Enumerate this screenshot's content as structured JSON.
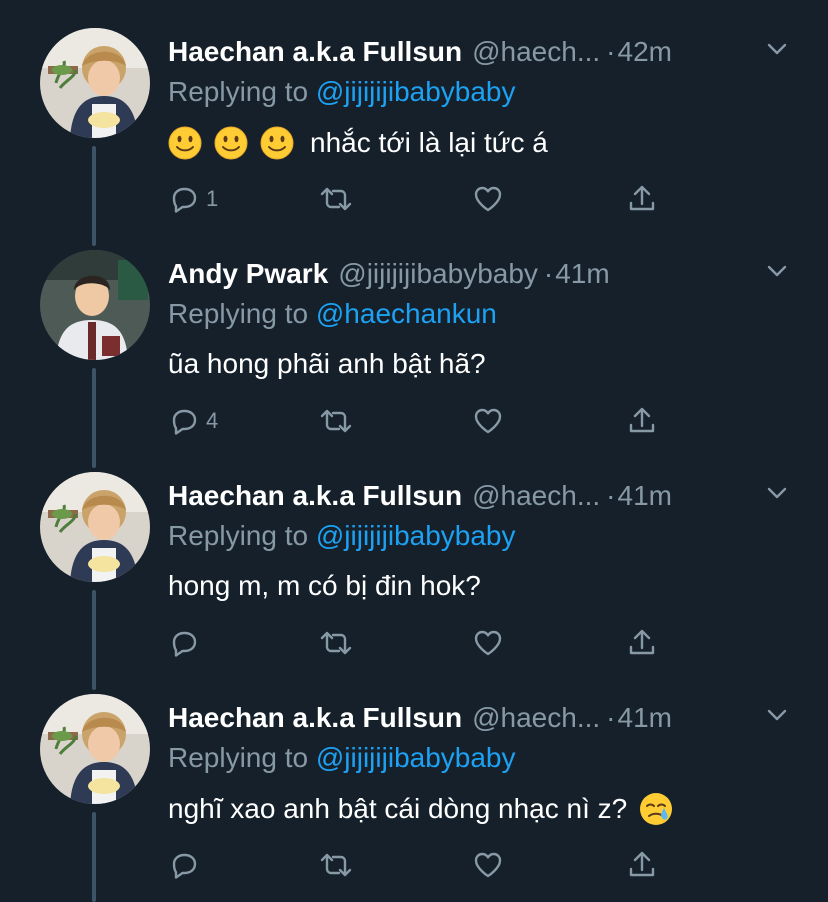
{
  "tweets": [
    {
      "name": "Haechan a.k.a Fullsun",
      "handle": "@haech...",
      "time": "42m",
      "reply_prefix": "Replying to ",
      "reply_to": "@jijijijibabybaby",
      "text": "nhắc tới là lại tức á",
      "emojis": [
        "slight-smile-emoji",
        "slight-smile-emoji",
        "slight-smile-emoji"
      ],
      "reply_count": "1",
      "avatar": "avatar-haechan"
    },
    {
      "name": "Andy Pwark",
      "handle": "@jijijijibabybaby",
      "time": "41m",
      "reply_prefix": "Replying to ",
      "reply_to": "@haechankun",
      "text": "ũa hong phãi anh bật hã?",
      "emojis": [],
      "reply_count": "4",
      "avatar": "avatar-andy"
    },
    {
      "name": "Haechan a.k.a Fullsun",
      "handle": "@haech...",
      "time": "41m",
      "reply_prefix": "Replying to ",
      "reply_to": "@jijijijibabybaby",
      "text": "hong m, m có bị đin hok?",
      "emojis": [],
      "reply_count": "",
      "avatar": "avatar-haechan"
    },
    {
      "name": "Haechan a.k.a Fullsun",
      "handle": "@haech...",
      "time": "41m",
      "reply_prefix": "Replying to ",
      "reply_to": "@jijijijibabybaby",
      "text": "nghĩ xao anh bật cái dòng nhạc nì z?",
      "emojis": [
        "crying-face-emoji"
      ],
      "reply_count": "",
      "avatar": "avatar-haechan"
    }
  ],
  "separator": "·",
  "colors": {
    "background": "#15202b",
    "text": "#ffffff",
    "secondary": "#8899a6",
    "link": "#1da1f2",
    "thread_line": "#3d5466"
  },
  "icons": [
    "reply-icon",
    "retweet-icon",
    "like-icon",
    "share-icon",
    "chevron-down-icon"
  ]
}
